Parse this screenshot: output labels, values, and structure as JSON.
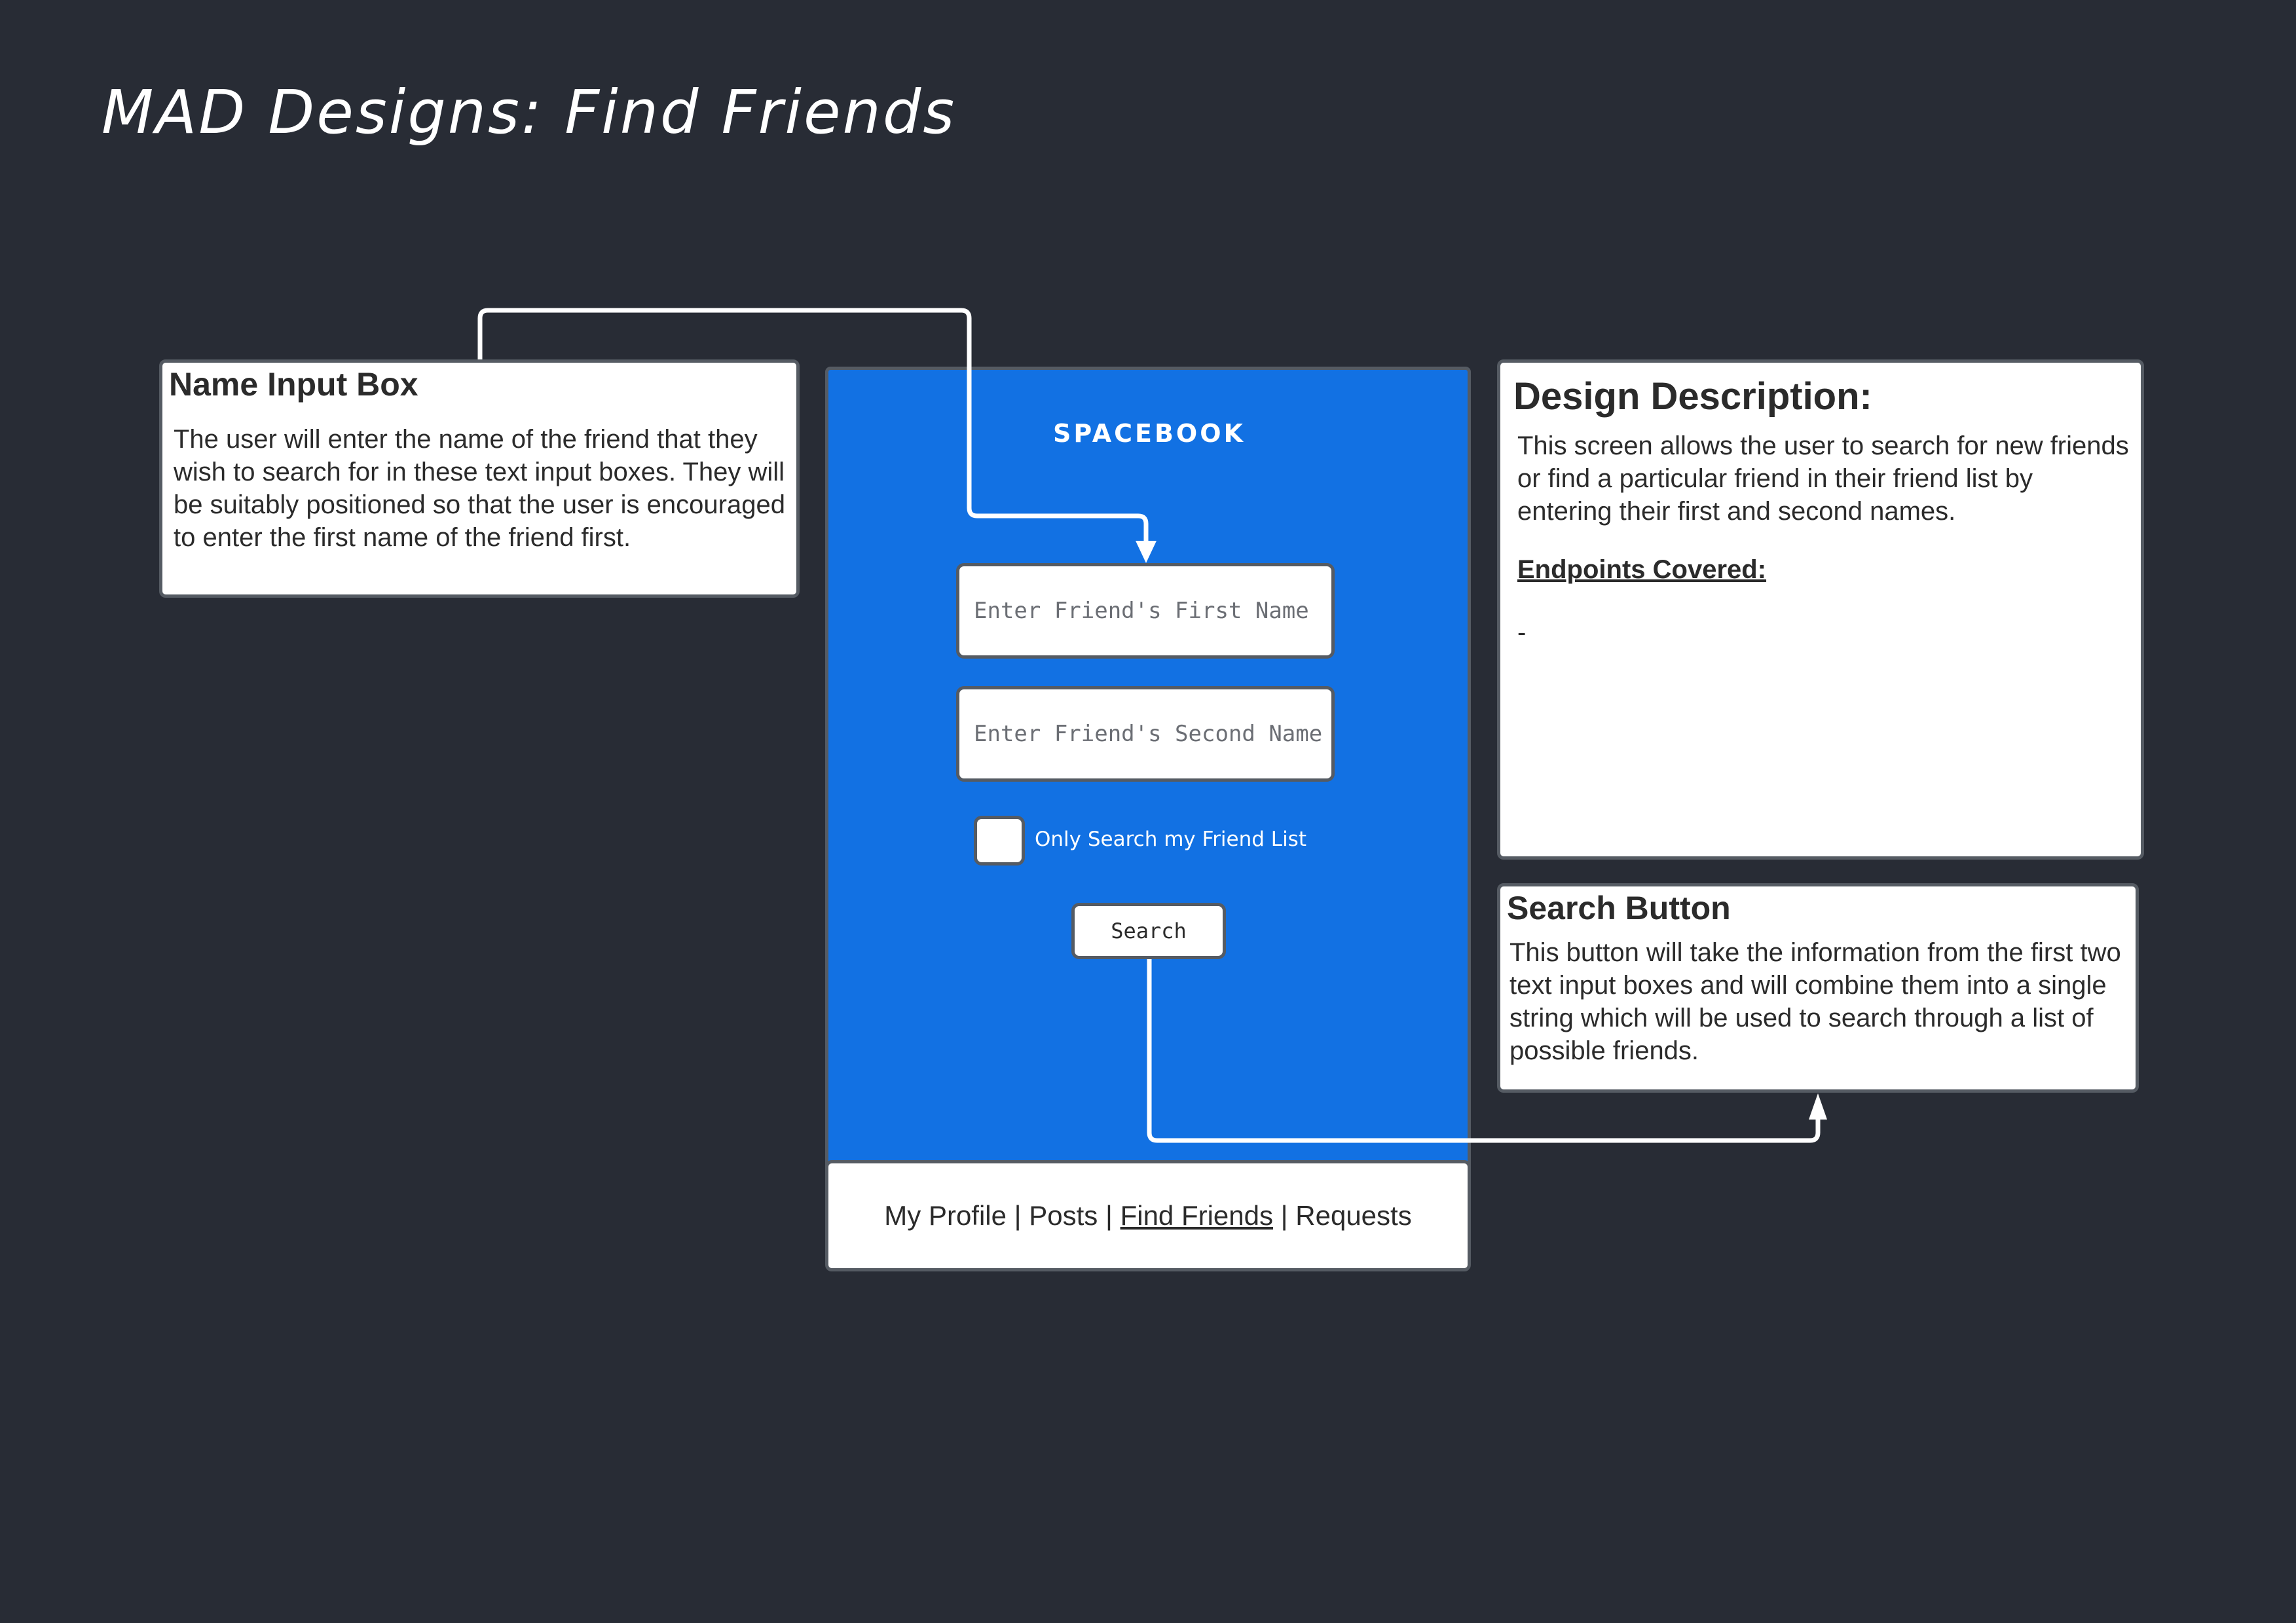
{
  "title": "MAD Designs: Find Friends",
  "notes": {
    "name_input": {
      "heading": "Name Input Box",
      "body": "The user will enter the name of the friend that they wish to search for in these text input boxes. They will be suitably positioned so that the user is encouraged to enter the first name of the friend first."
    },
    "design_description": {
      "heading": "Design Description:",
      "body": "This screen allows the user to search for new friends or find a particular friend in their friend list by entering their first and second names.",
      "endpoints_label": "Endpoints Covered:",
      "endpoints_value": "-"
    },
    "search_button": {
      "heading": "Search Button",
      "body": "This button will take the information from the first two text input boxes and will combine them into a single string which will be used to search through a list of possible friends."
    }
  },
  "app": {
    "logo": "SPACEBOOK",
    "first_name_placeholder": "Enter Friend's First Name",
    "second_name_placeholder": "Enter Friend's Second Name",
    "checkbox_label": "Only Search my Friend List",
    "checkbox_checked": false,
    "search_label": "Search",
    "nav": {
      "items": [
        "My Profile",
        "Posts",
        "Find Friends",
        "Requests"
      ],
      "separator": "|",
      "active": "Find Friends"
    }
  },
  "colors": {
    "background": "#282c35",
    "phone_blue": "#1271e3",
    "border": "#555b63"
  }
}
